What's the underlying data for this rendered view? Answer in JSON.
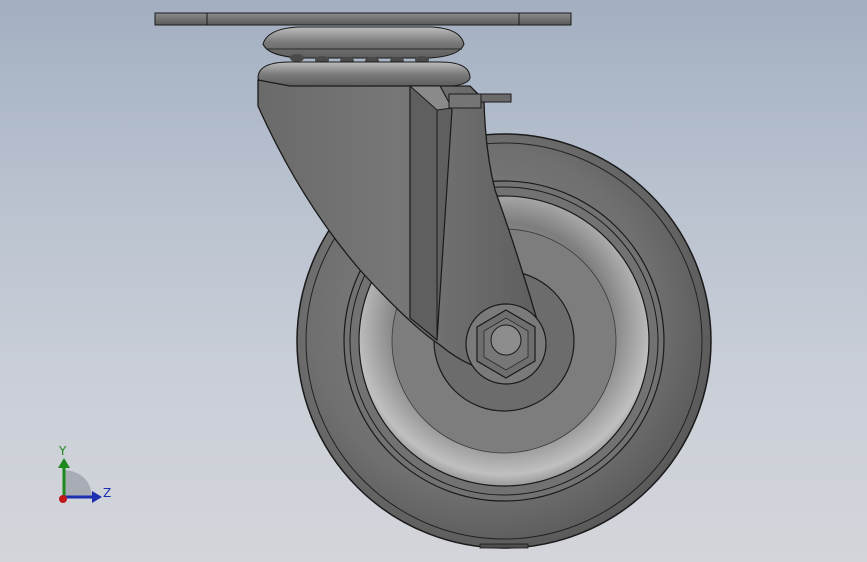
{
  "viewport": {
    "background_top": "#a3afc1",
    "background_bottom": "#d3d5da"
  },
  "model": {
    "object": "swivel-caster-wheel",
    "body_color": "#6e6e6e",
    "edge_color": "#1a1a1a"
  },
  "triad": {
    "y_label": "Y",
    "z_label": "Z",
    "y_color": "#1c8a1c",
    "z_color": "#1c2fb0",
    "x_color": "#c01818"
  }
}
